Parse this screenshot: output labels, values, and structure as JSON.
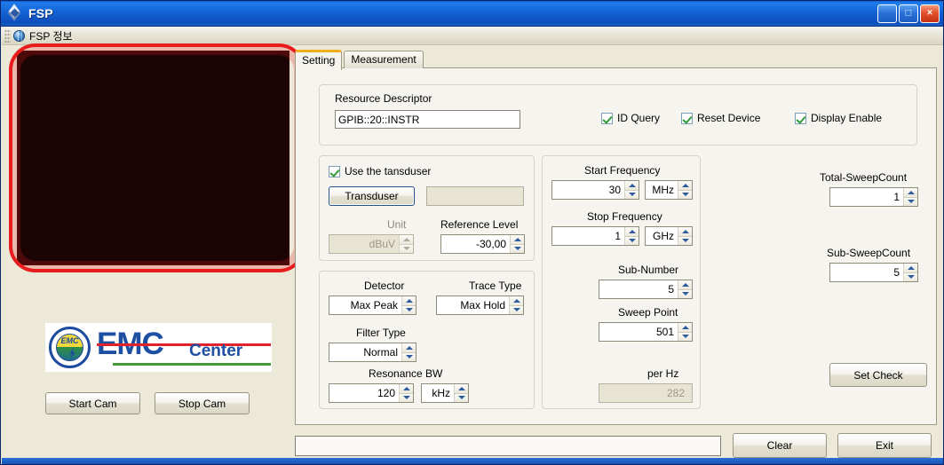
{
  "window": {
    "title": "FSP",
    "icon": "diamond-icon",
    "buttons": {
      "minimize": "_",
      "maximize": "□",
      "close": "×"
    }
  },
  "menu": {
    "items": [
      {
        "label": "FSP 정보",
        "icon": "globe-info-icon"
      }
    ]
  },
  "left_panel": {
    "camera_view_name": "camera-preview",
    "logo": {
      "emblem_text": "EMC",
      "word_main": "EMC",
      "word_sub": "Center"
    },
    "buttons": {
      "start_cam": "Start Cam",
      "stop_cam": "Stop Cam"
    }
  },
  "tabs": [
    {
      "label": "Setting",
      "active": true
    },
    {
      "label": "Measurement",
      "active": false
    }
  ],
  "resource": {
    "label": "Resource Descriptor",
    "value": "GPIB::20::INSTR",
    "checkboxes": [
      {
        "label": "ID Query",
        "checked": true
      },
      {
        "label": "Reset Device",
        "checked": true
      },
      {
        "label": "Display Enable",
        "checked": true
      }
    ]
  },
  "transducer": {
    "use_label": "Use the tansduser",
    "use_checked": true,
    "button_label": "Transduser",
    "file_value": "",
    "unit_label": "Unit",
    "unit_value": "dBuV",
    "unit_disabled": true,
    "reference_level_label": "Reference Level",
    "reference_level_value": "-30,00"
  },
  "detector": {
    "detector_label": "Detector",
    "detector_value": "Max Peak",
    "trace_type_label": "Trace Type",
    "trace_type_value": "Max Hold",
    "filter_type_label": "Filter Type",
    "filter_type_value": "Normal",
    "resonance_bw_label": "Resonance BW",
    "resonance_bw_value": "120",
    "resonance_bw_unit": "kHz"
  },
  "frequency": {
    "start_label": "Start Frequency",
    "start_value": "30",
    "start_unit": "MHz",
    "stop_label": "Stop Frequency",
    "stop_value": "1",
    "stop_unit": "GHz",
    "sub_number_label": "Sub-Number",
    "sub_number_value": "5",
    "sweep_point_label": "Sweep Point",
    "sweep_point_value": "501",
    "per_hz_label": "per Hz",
    "per_hz_value": "282"
  },
  "sweep": {
    "total_label": "Total-SweepCount",
    "total_value": "1",
    "sub_label": "Sub-SweepCount",
    "sub_value": "5",
    "set_check_label": "Set Check"
  },
  "bottom": {
    "status_value": "",
    "clear_label": "Clear",
    "exit_label": "Exit"
  },
  "colors": {
    "titlebar_blue": "#1565d8",
    "annotation_red": "#e81c1c",
    "tab_accent": "#f0ad1e",
    "logo_blue": "#1d4fa2",
    "logo_red": "#e2222a",
    "logo_green": "#3f9a35",
    "check_green": "#2f9b32",
    "form_beige": "#ece9d8"
  }
}
